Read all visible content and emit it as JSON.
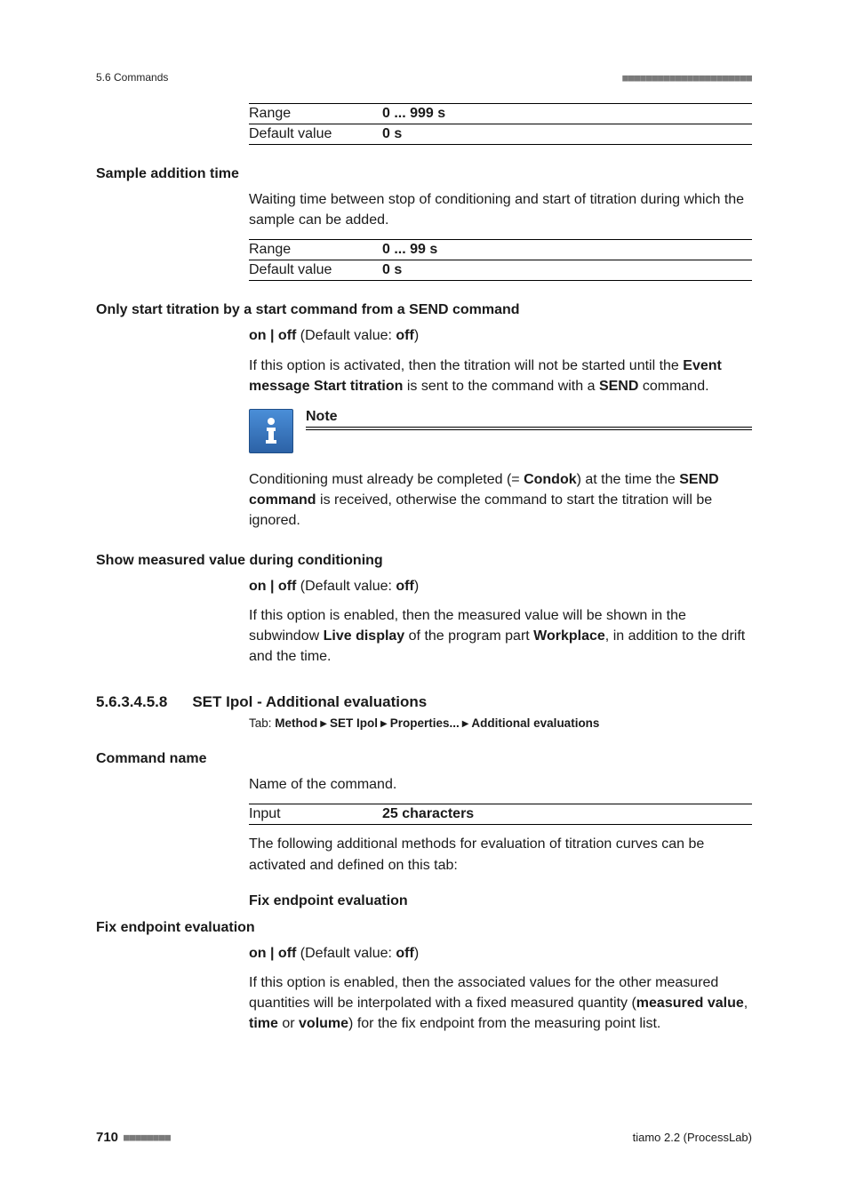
{
  "header": {
    "section": "5.6 Commands",
    "dashes": "■■■■■■■■■■■■■■■■■■■■■■"
  },
  "tables": {
    "pause_range_key": "Range",
    "pause_range_val": "0 ... 999 s",
    "pause_default_key": "Default value",
    "pause_default_val": "0 s",
    "sample_range_key": "Range",
    "sample_range_val": "0 ... 99 s",
    "sample_default_key": "Default value",
    "sample_default_val": "0 s",
    "input_key": "Input",
    "input_val": "25 characters"
  },
  "labels": {
    "sample_addition_time": "Sample addition time",
    "only_start": "Only start titration by a start command from a SEND command",
    "show_measured": "Show measured value during conditioning",
    "command_name": "Command name",
    "fix_ep_eval_sub": "Fix endpoint evaluation",
    "fix_ep_eval_label": "Fix endpoint evaluation"
  },
  "paragraphs": {
    "sample_desc": "Waiting time between stop of conditioning and start of titration during which the sample can be added.",
    "onoff_prefix": "on | off",
    "onoff_middle": " (Default value: ",
    "onoff_value": "off",
    "onoff_suffix": ")",
    "only_start_p_a": "If this option is activated, then the titration will not be started until the ",
    "only_start_p_b": "Event message Start titration",
    "only_start_p_c": " is sent to the command with a ",
    "only_start_p_d": "SEND",
    "only_start_p_e": " command.",
    "note_title": "Note",
    "note_body_a": "Conditioning must already be completed (= ",
    "note_body_b": "Condok",
    "note_body_c": ") at the time the ",
    "note_body_d": "SEND command",
    "note_body_e": " is received, otherwise the command to start the titration will be ignored.",
    "show_measured_p_a": "If this option is enabled, then the measured value will be shown in the subwindow ",
    "show_measured_p_b": "Live display",
    "show_measured_p_c": " of the program part ",
    "show_measured_p_d": "Workplace",
    "show_measured_p_e": ", in addition to the drift and the time.",
    "command_name_desc": "Name of the command.",
    "after_input": "The following additional methods for evaluation of titration curves can be activated and defined on this tab:",
    "fix_ep_p_a": "If this option is enabled, then the associated values for the other measured quantities will be interpolated with a fixed measured quantity (",
    "fix_ep_p_b": "measured value",
    "fix_ep_p_c": ", ",
    "fix_ep_p_d": "time",
    "fix_ep_p_e": " or ",
    "fix_ep_p_f": "volume",
    "fix_ep_p_g": ") for the fix endpoint from the measuring point list."
  },
  "section": {
    "num": "5.6.3.4.5.8",
    "title": "SET Ipol - Additional evaluations",
    "tab_label": "Tab: ",
    "crumbs": [
      "Method",
      "SET Ipol",
      "Properties...",
      "Additional evaluations"
    ]
  },
  "footer": {
    "page": "710",
    "dashes": "■■■■■■■■",
    "product": "tiamo 2.2 (ProcessLab)"
  }
}
